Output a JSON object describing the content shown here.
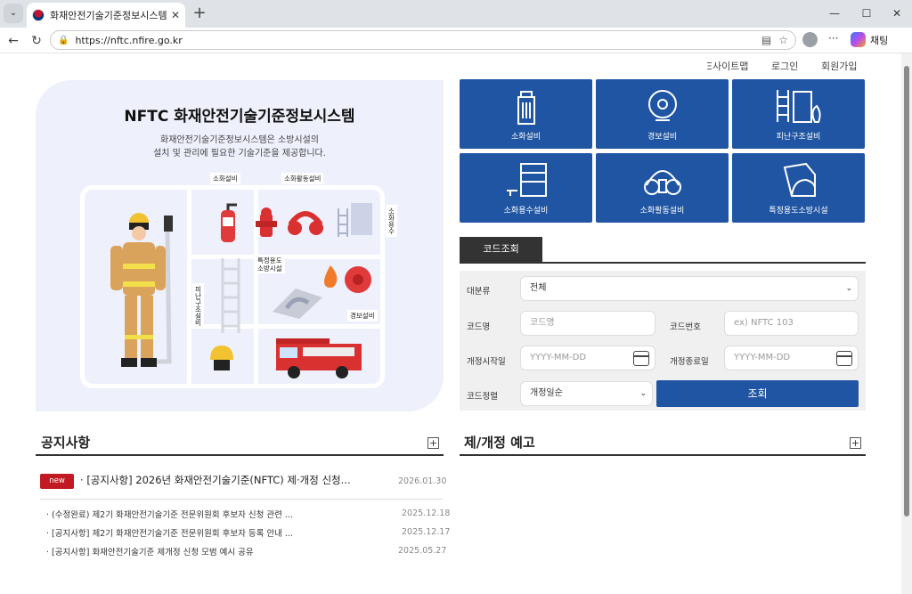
{
  "browser": {
    "tab_title": "화재안전기술기준정보시스템",
    "url": "https://nftc.nfire.go.kr",
    "chat_label": "채팅"
  },
  "util_nav": {
    "sitemap": "Ξ사이트맵",
    "login": "로그인",
    "signup": "회원가입"
  },
  "hero": {
    "title": "NFTC 화재안전기술기준정보시스템",
    "desc1": "화재안전기술기준정보시스템은 소방시설의",
    "desc2": "설치 및 관리에 필요한 기술기준을 제공합니다.",
    "tags": {
      "extinguish": "소화설비",
      "activity": "소화활동설비",
      "water": "소화용수",
      "special": "특정용도\n소방시설",
      "rescue": "피난구조설비",
      "alarm": "경보설비"
    }
  },
  "categories": [
    {
      "label": "소화설비",
      "icon": "hydrant-icon"
    },
    {
      "label": "경보설비",
      "icon": "bell-icon"
    },
    {
      "label": "피난구조설비",
      "icon": "escape-icon"
    },
    {
      "label": "소화용수설비",
      "icon": "water-tank-icon"
    },
    {
      "label": "소화활동설비",
      "icon": "gas-mask-icon"
    },
    {
      "label": "특정용도소방시설",
      "icon": "tunnel-icon"
    }
  ],
  "code_search": {
    "tab_label": "코드조회",
    "category_label": "대분류",
    "category_value": "전체",
    "code_name_label": "코드명",
    "code_name_placeholder": "코드명",
    "code_no_label": "코드번호",
    "code_no_placeholder": "ex) NFTC 103",
    "start_label": "개정시작일",
    "start_placeholder": "YYYY-MM-DD",
    "end_label": "개정종료일",
    "end_placeholder": "YYYY-MM-DD",
    "sort_label": "코드정렬",
    "sort_value": "개정일순",
    "search_button": "조회"
  },
  "notice": {
    "title": "공지사항",
    "new_badge": "new",
    "main_item": "[공지사항] 2026년 화재안전기술기준(NFTC) 제·개정 신청...",
    "main_date": "2026.01.30",
    "items": [
      {
        "text": "(수정완료) 제2기 화재안전기술기준 전문위원회 후보자 신청 관련 ...",
        "date": "2025.12.18"
      },
      {
        "text": "[공지사항] 제2기 화재안전기술기준 전문위원회 후보자 등록 안내 ...",
        "date": "2025.12.17"
      },
      {
        "text": "[공지사항] 화재안전기술기준 제개정 신청 모범 예시 공유",
        "date": "2025.05.27"
      }
    ]
  },
  "revision": {
    "title": "제/개정 예고"
  }
}
